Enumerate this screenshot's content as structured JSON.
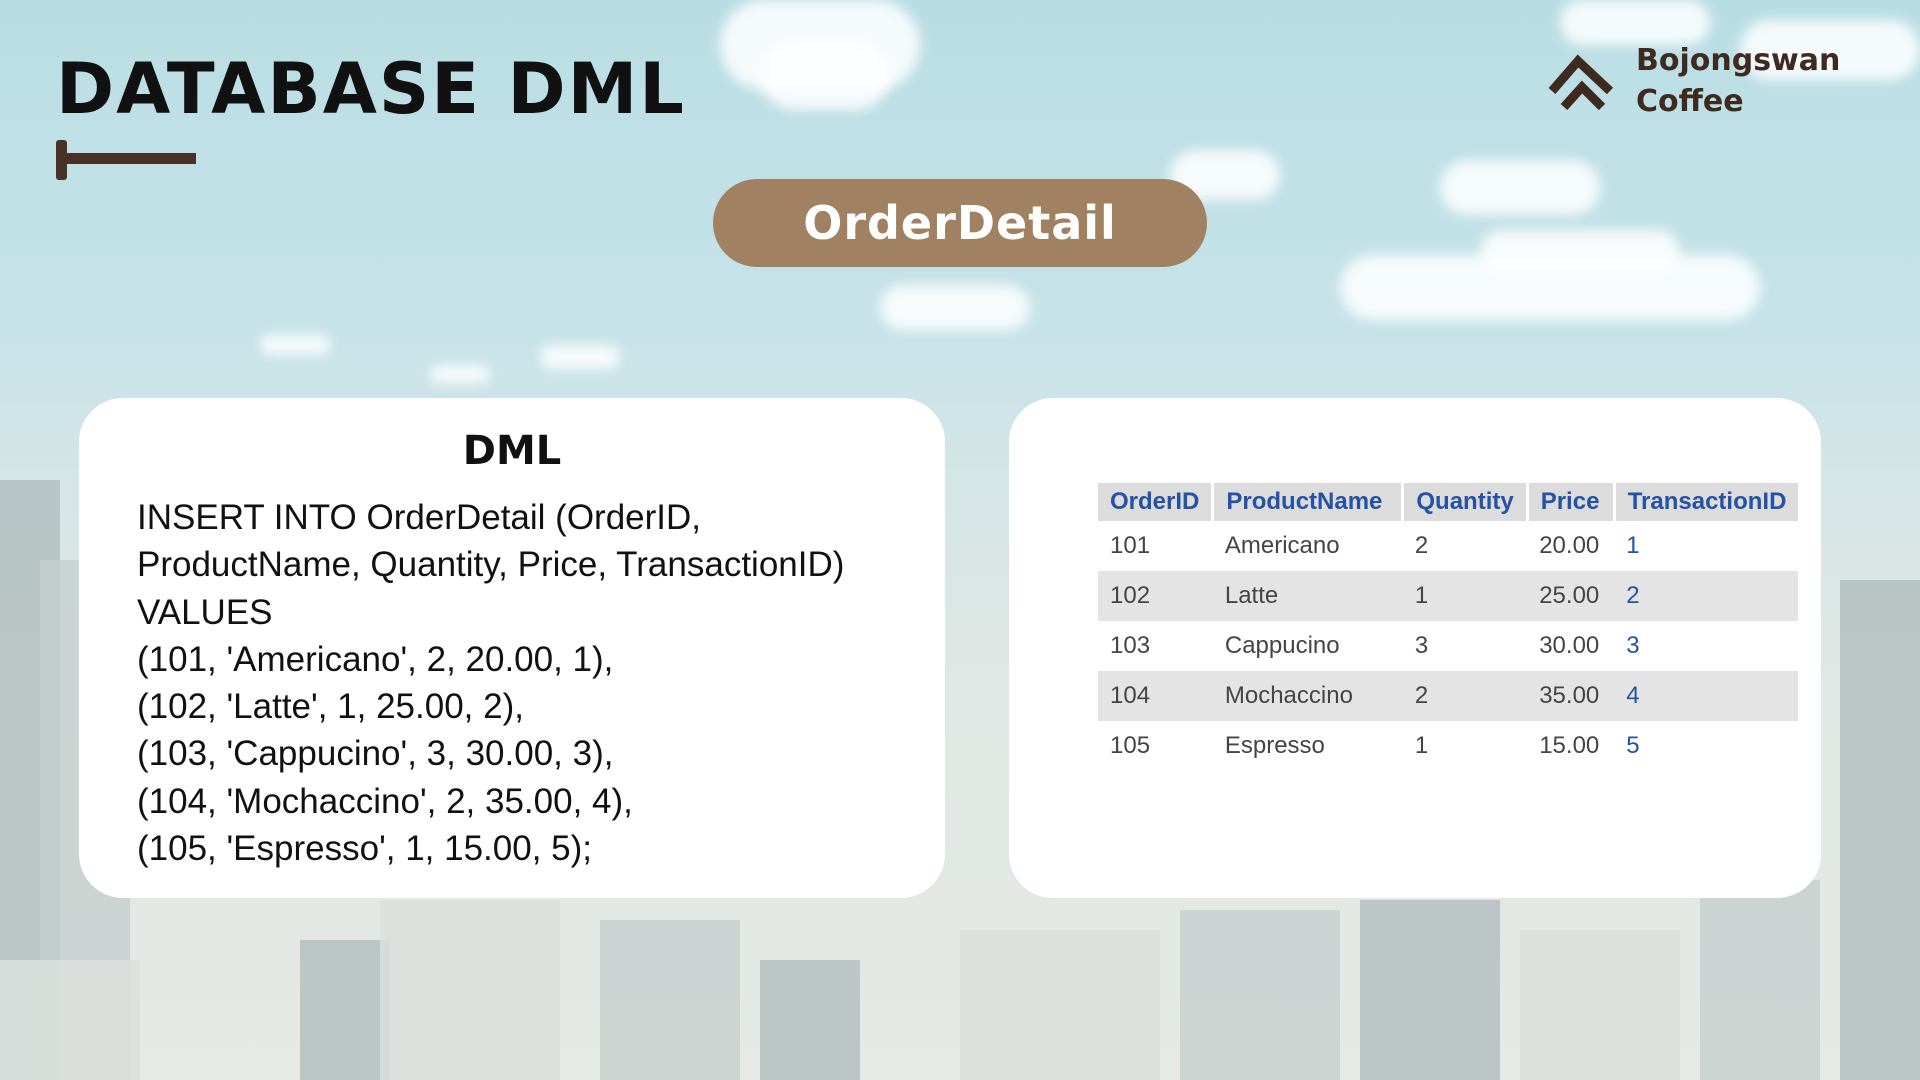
{
  "page_title": "DATABASE DML",
  "brand": {
    "line1": "Bojongswan",
    "line2": "Coffee",
    "icon": "chevron-up-logo-icon",
    "color": "#3f2a20"
  },
  "table_label": "OrderDetail",
  "accent_color": "#a08263",
  "dml_card": {
    "heading": "DML",
    "lines": [
      "INSERT INTO OrderDetail (OrderID,",
      "ProductName, Quantity, Price, TransactionID)",
      "VALUES",
      "(101, 'Americano', 2, 20.00, 1),",
      "(102, 'Latte', 1, 25.00, 2),",
      "(103, 'Cappucino', 3, 30.00, 3),",
      "(104, 'Mochaccino', 2, 35.00, 4),",
      "(105, 'Espresso', 1, 15.00, 5);"
    ]
  },
  "result_table": {
    "columns": [
      "OrderID",
      "ProductName",
      "Quantity",
      "Price",
      "TransactionID"
    ],
    "rows": [
      [
        "101",
        "Americano",
        "2",
        "20.00",
        "1"
      ],
      [
        "102",
        "Latte",
        "1",
        "25.00",
        "2"
      ],
      [
        "103",
        "Cappucino",
        "3",
        "30.00",
        "3"
      ],
      [
        "104",
        "Mochaccino",
        "2",
        "35.00",
        "4"
      ],
      [
        "105",
        "Espresso",
        "1",
        "15.00",
        "5"
      ]
    ]
  }
}
